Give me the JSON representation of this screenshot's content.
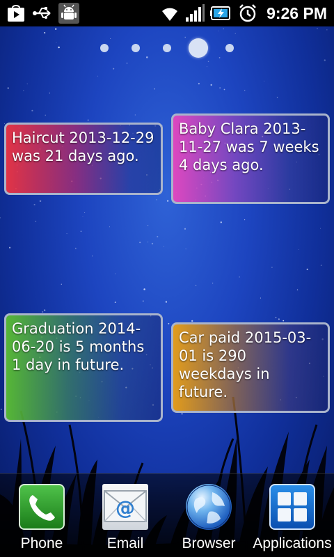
{
  "status_bar": {
    "time": "9:26 PM",
    "icons": [
      "play-store-notification-icon",
      "usb-icon",
      "android-debug-icon",
      "wifi-icon",
      "signal-icon",
      "battery-charging-icon",
      "alarm-icon"
    ]
  },
  "pager": {
    "pages": 5,
    "active_page": 4
  },
  "widgets": [
    {
      "text": "Haircut 2013-12-29 was 21 days ago."
    },
    {
      "text": "Baby Clara 2013-11-27 was 7 weeks 4 days ago."
    },
    {
      "text": "Graduation 2014-06-20 is 5 months 1 day in future."
    },
    {
      "text": "Car paid 2015-03-01 is 290 weekdays in future."
    }
  ],
  "dock": {
    "phone_label": "Phone",
    "email_label": "Email",
    "browser_label": "Browser",
    "apps_label": "Applications"
  }
}
